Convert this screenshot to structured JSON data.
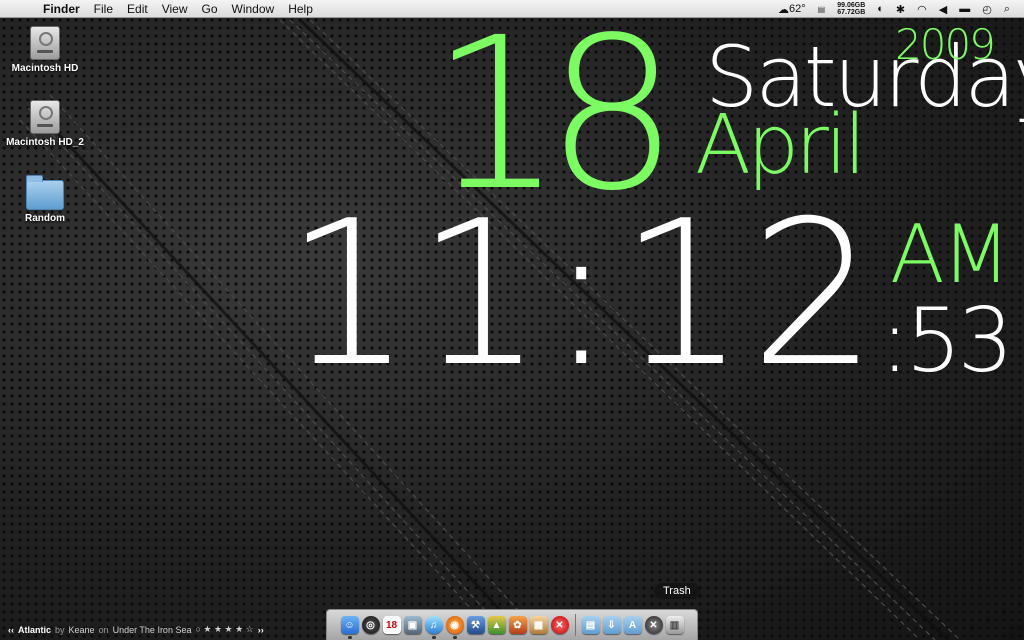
{
  "menubar": {
    "app_name": "Finder",
    "items": [
      "File",
      "Edit",
      "View",
      "Go",
      "Window",
      "Help"
    ],
    "temperature": "62°",
    "disk_a": "99.06GB",
    "disk_b": "67.72GB"
  },
  "desktop": {
    "icons": [
      {
        "label": "Macintosh HD",
        "icon": "hard-drive-icon"
      },
      {
        "label": "Macintosh HD_2",
        "icon": "hard-drive-icon"
      },
      {
        "label": "Random",
        "icon": "folder-icon"
      }
    ]
  },
  "clock": {
    "day": "18",
    "weekday": "Saturday",
    "year": "2009",
    "month": "April",
    "time": "11:12",
    "ampm": "AM",
    "seconds": ":53",
    "accent_color": "#7dfb63"
  },
  "music": {
    "prev": "‹‹",
    "song": "Atlantic",
    "by": "by",
    "artist": "Keane",
    "on": "on",
    "album": "Under The Iron Sea",
    "rating": "○ ★ ★ ★ ★ ☆",
    "next": "››"
  },
  "dock": {
    "tooltip": "Trash",
    "apps": [
      "finder",
      "dashboard",
      "ical",
      "preview",
      "itunes",
      "firefox",
      "xcode",
      "activity",
      "photos",
      "pdf",
      "stop",
      "documents",
      "downloads",
      "applications",
      "system",
      "trash"
    ]
  }
}
